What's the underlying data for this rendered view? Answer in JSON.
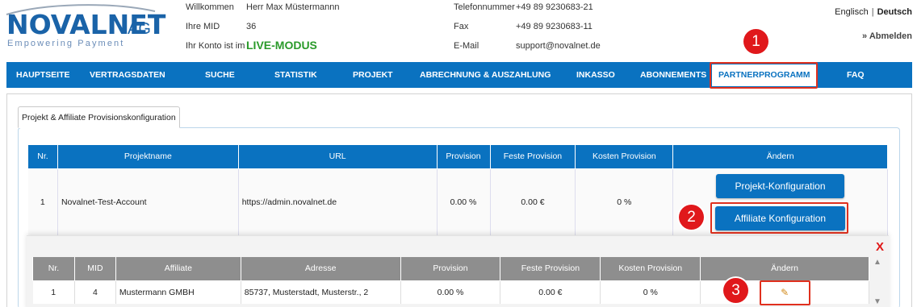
{
  "brand": {
    "name": "NOVALNET",
    "suffix": "AG",
    "tagline": "Empowering Payment",
    "color": "#1a63a8"
  },
  "header": {
    "welcome_label": "Willkommen",
    "welcome_value": "Herr Max Müstermannn",
    "mid_label": "Ihre MID",
    "mid_value": "36",
    "mode_label": "Ihr Konto ist im",
    "mode_value": "LIVE-MODUS",
    "phone_label": "Telefonnummer",
    "phone_value": "+49 89 9230683-21",
    "fax_label": "Fax",
    "fax_value": "+49 89 9230683-11",
    "email_label": "E-Mail",
    "email_value": "support@novalnet.de",
    "lang_en": "Englisch",
    "lang_sep": "|",
    "lang_de": "Deutsch",
    "logout": "» Abmelden"
  },
  "nav": {
    "color": "#0a72c0",
    "items": [
      {
        "label": "HAUPTSEITE"
      },
      {
        "label": "VERTRAGSDATEN"
      },
      {
        "label": "SUCHE"
      },
      {
        "label": "STATISTIK"
      },
      {
        "label": "PROJEKT"
      },
      {
        "label": "ABRECHNUNG & AUSZAHLUNG"
      },
      {
        "label": "INKASSO"
      },
      {
        "label": "ABONNEMENTS"
      },
      {
        "label": "PARTNERPROGRAMM",
        "active": true
      },
      {
        "label": "FAQ"
      }
    ]
  },
  "annotations": {
    "color": "#e0181b",
    "labels": [
      "1",
      "2",
      "3"
    ]
  },
  "tab": {
    "label": "Projekt & Affiliate Provisionskonfiguration"
  },
  "projects_table": {
    "headers": [
      "Nr.",
      "Projektname",
      "URL",
      "Provision",
      "Feste Provision",
      "Kosten Provision",
      "Ändern"
    ],
    "rows": [
      {
        "nr": "1",
        "name": "Novalnet-Test-Account",
        "url": "https://admin.novalnet.de",
        "provision": "0.00 %",
        "feste": "0.00 €",
        "kosten": "0 %"
      }
    ],
    "btn_project": "Projekt-Konfiguration",
    "btn_affiliate": "Affiliate Konfiguration"
  },
  "affiliate_table": {
    "close": "X",
    "headers": [
      "Nr.",
      "MID",
      "Affiliate",
      "Adresse",
      "Provision",
      "Feste Provision",
      "Kosten Provision",
      "Ändern"
    ],
    "rows": [
      {
        "nr": "1",
        "mid": "4",
        "affiliate": "Mustermann GMBH",
        "adresse": "85737, Musterstadt, Musterstr., 2",
        "provision": "0.00 %",
        "feste": "0.00 €",
        "kosten": "0 %"
      }
    ]
  }
}
